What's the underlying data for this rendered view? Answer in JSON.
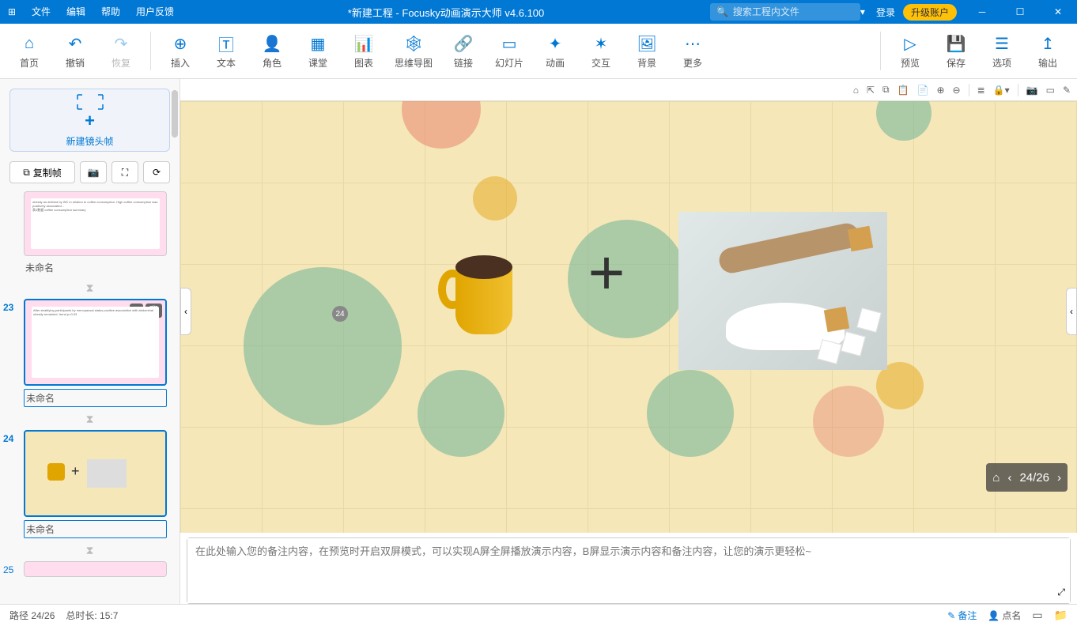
{
  "title": "*新建工程 - Focusky动画演示大师  v4.6.100",
  "menu": {
    "file": "文件",
    "edit": "编辑",
    "help": "帮助",
    "feedback": "用户反馈"
  },
  "search_placeholder": "搜索工程内文件",
  "login": "登录",
  "upgrade": "升级账户",
  "ribbon": {
    "home": "首页",
    "undo": "撤销",
    "redo": "恢复",
    "insert": "插入",
    "text": "文本",
    "role": "角色",
    "classroom": "课堂",
    "chart": "图表",
    "mindmap": "思维导图",
    "link": "链接",
    "slide": "幻灯片",
    "anim": "动画",
    "interact": "交互",
    "bg": "背景",
    "more": "更多",
    "preview": "预览",
    "save": "保存",
    "options": "选项",
    "export": "输出"
  },
  "sidebar": {
    "newframe": "新建镜头帧",
    "copyframe": "复制帧",
    "slides": [
      {
        "num": "",
        "label": "未命名"
      },
      {
        "num": "23",
        "label": "未命名"
      },
      {
        "num": "24",
        "label": "未命名"
      },
      {
        "num": "25",
        "label": ""
      }
    ]
  },
  "canvas": {
    "tag": "24",
    "navpos": "24/26"
  },
  "notes_placeholder": "在此处输入您的备注内容，在预览时开启双屏模式，可以实现A屏全屏播放演示内容，B屏显示演示内容和备注内容，让您的演示更轻松~",
  "status": {
    "path": "路径 24/26",
    "duration": "总时长: 15:7",
    "notes": "备注",
    "likes": "点名"
  }
}
